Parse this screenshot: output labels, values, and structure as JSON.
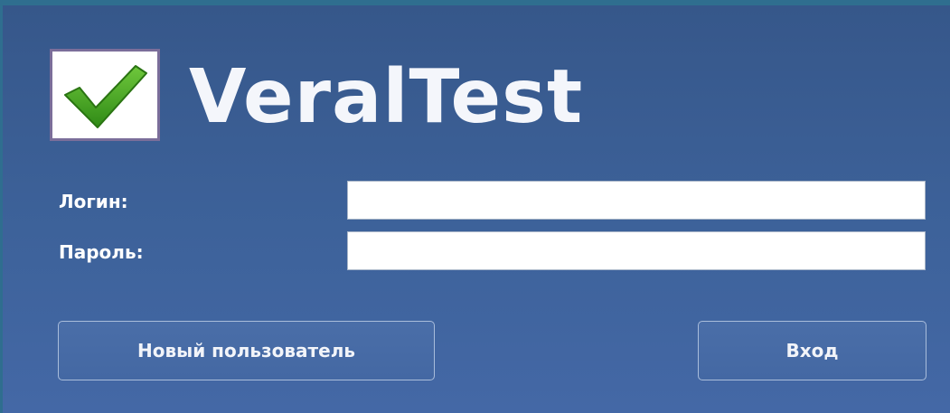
{
  "app": {
    "title": "VeralTest",
    "logo_icon": "checkmark-icon",
    "accent_color": "#3c9a1f"
  },
  "form": {
    "login_label": "Логин:",
    "login_value": "",
    "password_label": "Пароль:",
    "password_value": ""
  },
  "buttons": {
    "new_user_label": "Новый пользователь",
    "login_label": "Вход"
  }
}
